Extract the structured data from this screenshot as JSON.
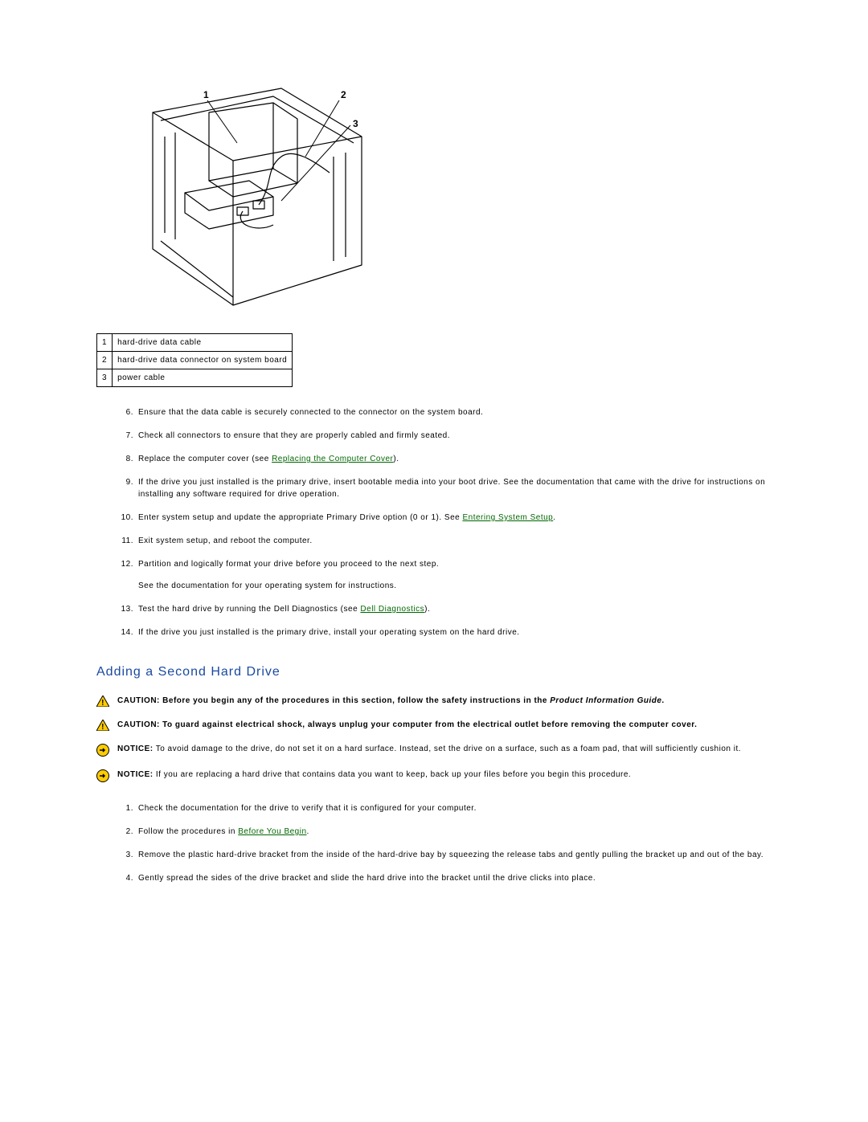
{
  "figure_callouts": {
    "c1": "1",
    "c2": "2",
    "c3": "3"
  },
  "legend": [
    {
      "n": "1",
      "label": "hard-drive data cable"
    },
    {
      "n": "2",
      "label": "hard-drive data connector on system board"
    },
    {
      "n": "3",
      "label": "power cable"
    }
  ],
  "steps_a": {
    "s6": {
      "n": "6.",
      "text": "Ensure that the data cable is securely connected to the connector on the system board."
    },
    "s7": {
      "n": "7.",
      "text": "Check all connectors to ensure that they are properly cabled and firmly seated."
    },
    "s8": {
      "n": "8.",
      "pre": "Replace the computer cover (see ",
      "link": "Replacing the Computer Cover",
      "post": ")."
    },
    "s9": {
      "n": "9.",
      "text": "If the drive you just installed is the primary drive, insert bootable media into your boot drive. See the documentation that came with the drive for instructions on installing any software required for drive operation."
    },
    "s10": {
      "n": "10.",
      "pre": "Enter system setup and update the appropriate Primary Drive option (0 or 1). See ",
      "link": "Entering System Setup",
      "post": "."
    },
    "s11": {
      "n": "11.",
      "text": "Exit system setup, and reboot the computer."
    },
    "s12": {
      "n": "12.",
      "text": "Partition and logically format your drive before you proceed to the next step.",
      "sub": "See the documentation for your operating system for instructions."
    },
    "s13": {
      "n": "13.",
      "pre": "Test the hard drive by running the Dell Diagnostics (see ",
      "link": "Dell Diagnostics",
      "post": ")."
    },
    "s14": {
      "n": "14.",
      "text": "If the drive you just installed is the primary drive, install your operating system on the hard drive."
    }
  },
  "section_heading": "Adding a Second Hard Drive",
  "notices": {
    "c1": {
      "label": "CAUTION:",
      "pre": " Before you begin any of the procedures in this section, follow the safety instructions in the ",
      "ital": "Product Information Guide",
      "post": "."
    },
    "c2": {
      "label": "CAUTION:",
      "text": " To guard against electrical shock, always unplug your computer from the electrical outlet before removing the computer cover."
    },
    "n1": {
      "label": "NOTICE:",
      "text": " To avoid damage to the drive, do not set it on a hard surface. Instead, set the drive on a surface, such as a foam pad, that will sufficiently cushion it."
    },
    "n2": {
      "label": "NOTICE:",
      "text": " If you are replacing a hard drive that contains data you want to keep, back up your files before you begin this procedure."
    }
  },
  "steps_b": {
    "s1": {
      "n": "1.",
      "text": "Check the documentation for the drive to verify that it is configured for your computer."
    },
    "s2": {
      "n": "2.",
      "pre": "Follow the procedures in ",
      "link": "Before You Begin",
      "post": "."
    },
    "s3": {
      "n": "3.",
      "text": "Remove the plastic hard-drive bracket from the inside of the hard-drive bay by squeezing the release tabs and gently pulling the bracket up and out of the bay."
    },
    "s4": {
      "n": "4.",
      "text": "Gently spread the sides of the drive bracket and slide the hard drive into the bracket until the drive clicks into place."
    }
  }
}
